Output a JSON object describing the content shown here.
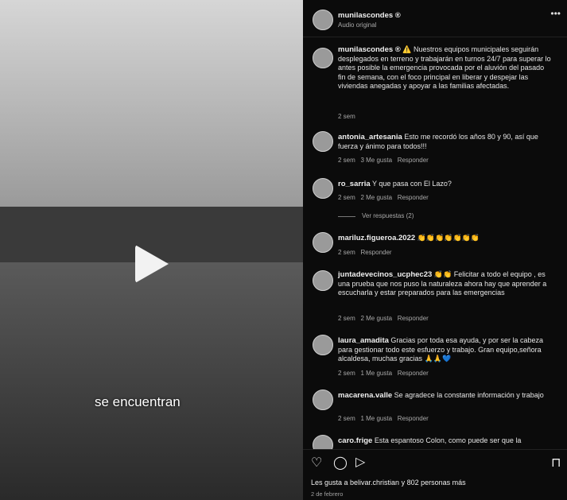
{
  "video": {
    "caption": "se encuentran"
  },
  "header": {
    "username": "munilascondes ®",
    "audio": "Audio original"
  },
  "post": {
    "username": "munilascondes ®",
    "text": "⚠️ Nuestros equipos municipales seguirán desplegados en terreno y trabajarán en turnos 24/7 para superar lo antes posible la emergencia provocada por el aluvión del pasado fin de semana, con el foco principal en liberar y despejar las viviendas anegadas y apoyar a las familias afectadas.",
    "time": "2 sem"
  },
  "comments": [
    {
      "user": "antonia_artesania",
      "text": "Esto me recordó los años 80 y 90, así que fuerza y ánimo para todos!!!",
      "meta": "2 sem   3 Me gusta   Responder"
    },
    {
      "user": "ro_sarria",
      "text": "Y que pasa con El Lazo?",
      "meta": "2 sem   2 Me gusta   Responder",
      "replies": "Ver respuestas (2)"
    },
    {
      "user": "mariluz.figueroa.2022",
      "text": "👏👏👏👏👏👏👏",
      "meta": "2 sem   Responder"
    },
    {
      "user": "juntadevecinos_ucphec23",
      "text": "👏👏 Felicitar a todo el equipo , es una prueba que nos puso la naturaleza ahora hay que aprender a escucharla y estar preparados para las emergencias",
      "meta": "2 sem   2 Me gusta   Responder"
    },
    {
      "user": "laura_amadita",
      "text": "Gracias por toda esa ayuda, y por ser la cabeza para gestionar todo este esfuerzo y trabajo. Gran equipo,señora alcaldesa, muchas gracias 🙏🙏💙",
      "meta": "2 sem   1 Me gusta   Responder"
    },
    {
      "user": "macarena.valle",
      "text": "Se agradece la constante información y trabajo",
      "meta": "2 sem   1 Me gusta   Responder"
    },
    {
      "user": "caro.frige",
      "text": "Esta espantoso Colon, como puede ser que la",
      "meta": ""
    }
  ],
  "footer": {
    "likes": "Les gusta a belivar.christian y 802 personas más",
    "date": "2 de febrero"
  }
}
